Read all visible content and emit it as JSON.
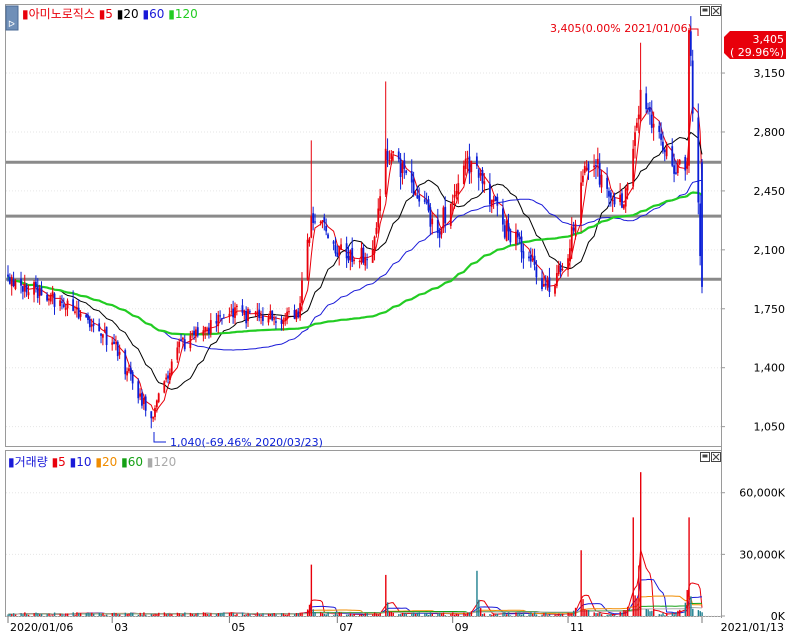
{
  "colors": {
    "up": "#e8000b",
    "down": "#0b1fd6",
    "ma5": "#e8000b",
    "ma20": "#000000",
    "ma60": "#1a1ad8",
    "ma120": "#22cc22",
    "vol_ma5": "#e8000b",
    "vol_ma10": "#1a1ad8",
    "vol_ma20": "#f08c00",
    "vol_ma60": "#14a014",
    "vol_ma120": "#aaaaaa",
    "hline": "#8a8a8a"
  },
  "price_legend": {
    "name": "아미노로직스",
    "ma5": "5",
    "ma20": "20",
    "ma60": "60",
    "ma120": "120"
  },
  "volume_legend": {
    "name": "거래량",
    "ma5": "5",
    "ma10": "10",
    "ma20": "20",
    "ma60": "60",
    "ma120": "120"
  },
  "max_annotation": "3,405(0.00% 2021/01/06)",
  "min_annotation": "1,040(-69.46% 2020/03/23)",
  "last_price_tag": {
    "price": "3,405",
    "change": "( 29.96%)"
  },
  "chart_data": [
    {
      "type": "candlestick",
      "panel": "price",
      "y_ticks": [
        "3,150",
        "2,800",
        "2,450",
        "2,100",
        "1,750",
        "1,400",
        "1,050"
      ],
      "y_tick_values": [
        3150,
        2800,
        2450,
        2100,
        1750,
        1400,
        1050
      ],
      "ylim": [
        935,
        3560
      ],
      "xlim": [
        "2020/01/06",
        "2021/01/13"
      ],
      "x_ticks": [
        "2020/01/06",
        "03",
        "05",
        "07",
        "09",
        "11",
        "2021/01/13"
      ],
      "x_tick_dates": [
        "2020/01/06",
        "2020/03/02",
        "2020/05/04",
        "2020/07/01",
        "2020/09/01",
        "2020/11/02",
        "2021/01/13"
      ],
      "horizontal_lines": [
        2620,
        2300,
        1925
      ],
      "keypoints": [
        {
          "date": "2020/01/06",
          "close": 1940
        },
        {
          "date": "2020/02/03",
          "close": 1800
        },
        {
          "date": "2020/03/02",
          "close": 1550
        },
        {
          "date": "2020/03/23",
          "low": 1040,
          "close": 1100
        },
        {
          "date": "2020/04/06",
          "close": 1520
        },
        {
          "date": "2020/05/04",
          "close": 1720
        },
        {
          "date": "2020/06/10",
          "close": 1700
        },
        {
          "date": "2020/06/17",
          "close": 2300,
          "high": 2750
        },
        {
          "date": "2020/07/06",
          "close": 2050
        },
        {
          "date": "2020/07/20",
          "close": 2100
        },
        {
          "date": "2020/07/27",
          "close": 2700,
          "high": 3100
        },
        {
          "date": "2020/08/10",
          "close": 2500
        },
        {
          "date": "2020/08/24",
          "close": 2200
        },
        {
          "date": "2020/09/07",
          "close": 2600
        },
        {
          "date": "2020/09/14",
          "close": 2600
        },
        {
          "date": "2020/09/28",
          "close": 2250
        },
        {
          "date": "2020/10/12",
          "close": 2050
        },
        {
          "date": "2020/10/23",
          "close": 1850
        },
        {
          "date": "2020/11/02",
          "close": 2050
        },
        {
          "date": "2020/11/09",
          "close": 2500
        },
        {
          "date": "2020/11/16",
          "close": 2600
        },
        {
          "date": "2020/12/01",
          "close": 2350
        },
        {
          "date": "2020/12/07",
          "close": 2700
        },
        {
          "date": "2020/12/11",
          "close": 3050,
          "high": 3330
        },
        {
          "date": "2020/12/21",
          "close": 2800
        },
        {
          "date": "2020/12/28",
          "close": 2600
        },
        {
          "date": "2021/01/05",
          "close": 2620
        },
        {
          "date": "2021/01/06",
          "close": 3405,
          "high": 3405
        },
        {
          "date": "2021/01/13",
          "open": 2620,
          "close": 1880
        }
      ],
      "moving_averages": [
        {
          "name": "5",
          "period": 5
        },
        {
          "name": "20",
          "period": 20
        },
        {
          "name": "60",
          "period": 60
        },
        {
          "name": "120",
          "period": 120
        }
      ]
    },
    {
      "type": "bar",
      "panel": "volume",
      "y_ticks": [
        "60,000K",
        "30,000K",
        "0K"
      ],
      "y_tick_values": [
        60000,
        30000,
        0
      ],
      "ylim": [
        0,
        73000
      ],
      "units": "K",
      "spikes": [
        {
          "date": "2020/06/17",
          "value": 25000
        },
        {
          "date": "2020/07/27",
          "value": 20000
        },
        {
          "date": "2020/09/14",
          "value": 22000
        },
        {
          "date": "2020/11/09",
          "value": 32000
        },
        {
          "date": "2020/12/07",
          "value": 48000
        },
        {
          "date": "2020/12/11",
          "value": 70000
        },
        {
          "date": "2021/01/06",
          "value": 48000
        }
      ]
    }
  ]
}
